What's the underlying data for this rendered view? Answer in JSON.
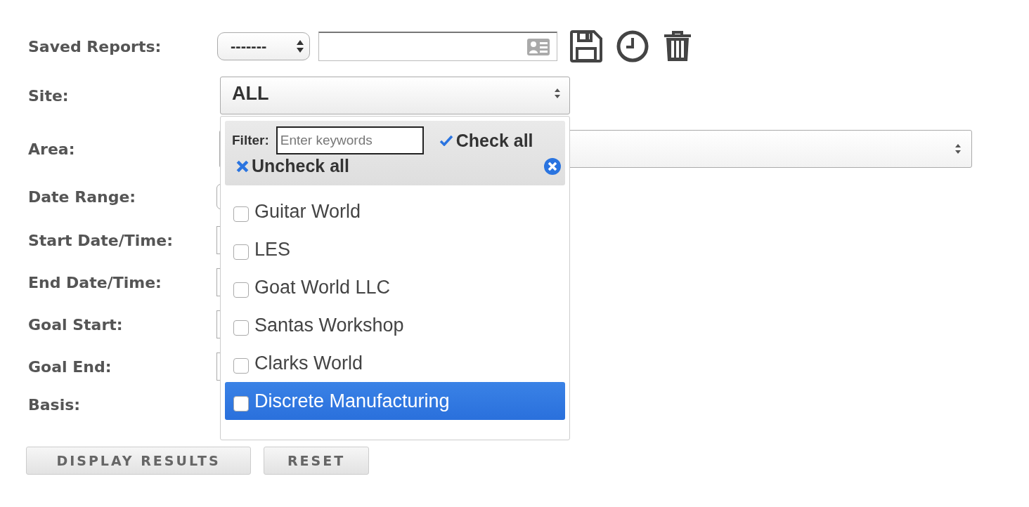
{
  "rows": [
    {
      "label": "Saved Reports:",
      "kind": "saved",
      "value": "-------"
    },
    {
      "label": "Site:",
      "kind": "select",
      "value": "ALL"
    },
    {
      "label": "Area:",
      "kind": "select"
    },
    {
      "label": "Date Range:",
      "kind": "input"
    },
    {
      "label": "Start Date/Time:",
      "kind": "input"
    },
    {
      "label": "End Date/Time:",
      "kind": "input"
    },
    {
      "label": "Goal Start:",
      "kind": "input"
    },
    {
      "label": "Goal End:",
      "kind": "input"
    },
    {
      "label": "Basis:",
      "kind": "plain"
    }
  ],
  "dropdown": {
    "filter_label": "Filter:",
    "filter_placeholder": "Enter keywords",
    "check_all": "Check all",
    "uncheck_all": "Uncheck all",
    "options": [
      {
        "label": "Guitar World",
        "checked": false,
        "selected": false
      },
      {
        "label": "LES",
        "checked": false,
        "selected": false
      },
      {
        "label": "Goat World LLC",
        "checked": false,
        "selected": false
      },
      {
        "label": "Santas Workshop",
        "checked": false,
        "selected": false
      },
      {
        "label": "Clarks World",
        "checked": false,
        "selected": false
      },
      {
        "label": "Discrete Manufacturing",
        "checked": false,
        "selected": true
      }
    ]
  },
  "buttons": [
    "DISPLAY RESULTS",
    "RESET"
  ]
}
